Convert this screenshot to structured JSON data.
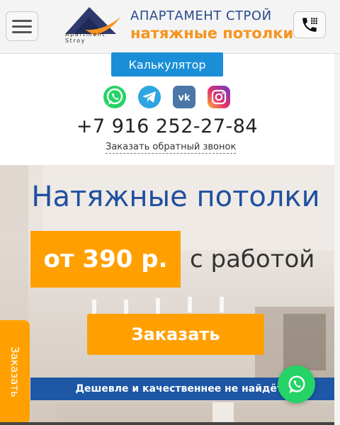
{
  "header": {
    "logo_text_line1": "Apartment",
    "logo_text_line2": "Stroy",
    "brand_top": "АПАРТАМЕНТ СТРОЙ",
    "brand_bottom": "натяжные потолки",
    "menu_icon": "hamburger-icon",
    "call_icon": "phone-icon"
  },
  "contacts": {
    "calculator_label": "Калькулятор",
    "social_icons": [
      "whatsapp-icon",
      "telegram-icon",
      "vk-icon",
      "instagram-icon"
    ],
    "phone": "+7 916 252-27-84",
    "callback_label": "Заказать обратный звонок"
  },
  "hero": {
    "title": "Натяжные потолки",
    "price": "от 390 р.",
    "price_suffix": "с работой",
    "order_label": "Заказать",
    "banner": "Дешевле и качественнее не найдёте"
  },
  "side_tab": {
    "label": "Заказать"
  },
  "floating": {
    "icon": "whatsapp-icon"
  },
  "colors": {
    "accent_orange": "#ffa000",
    "brand_blue": "#1f4fa0",
    "calc_blue": "#1a8fd8",
    "banner_blue": "#1d57a5",
    "whatsapp_green": "#25d366"
  }
}
